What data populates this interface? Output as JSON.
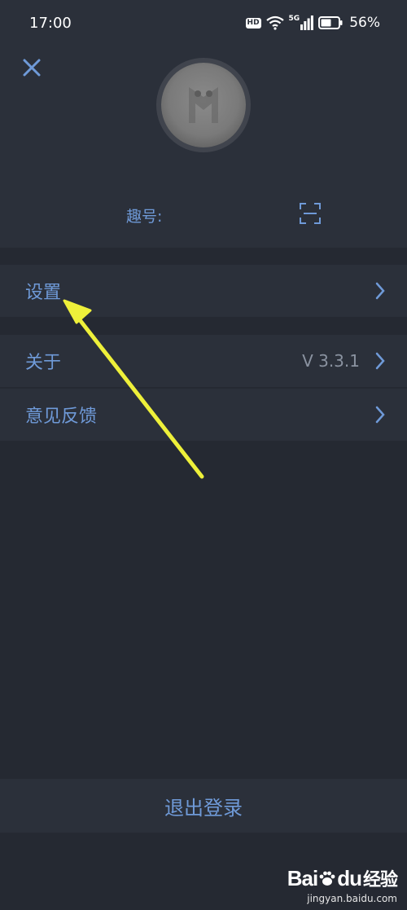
{
  "status_bar": {
    "time": "17:00",
    "hd_badge": "HD",
    "network_badge": "5G",
    "battery": "56%",
    "icons": [
      "wifi-icon",
      "signal-icon",
      "battery-icon"
    ]
  },
  "header": {
    "close_icon": "close-icon",
    "qu_label": "趣号:",
    "scan_icon": "scan-icon"
  },
  "menu": {
    "settings": {
      "label": "设置"
    },
    "about": {
      "label": "关于",
      "value": "V 3.3.1"
    },
    "feedback": {
      "label": "意见反馈"
    }
  },
  "logout": {
    "label": "退出登录"
  },
  "watermark": {
    "logo_bai": "Bai",
    "logo_du": "du",
    "logo_jingyan": "经验",
    "url": "jingyan.baidu.com"
  },
  "colors": {
    "background": "#252932",
    "panel": "#2b303a",
    "accent": "#6f9ad8",
    "annotation_arrow": "#eef03a"
  }
}
